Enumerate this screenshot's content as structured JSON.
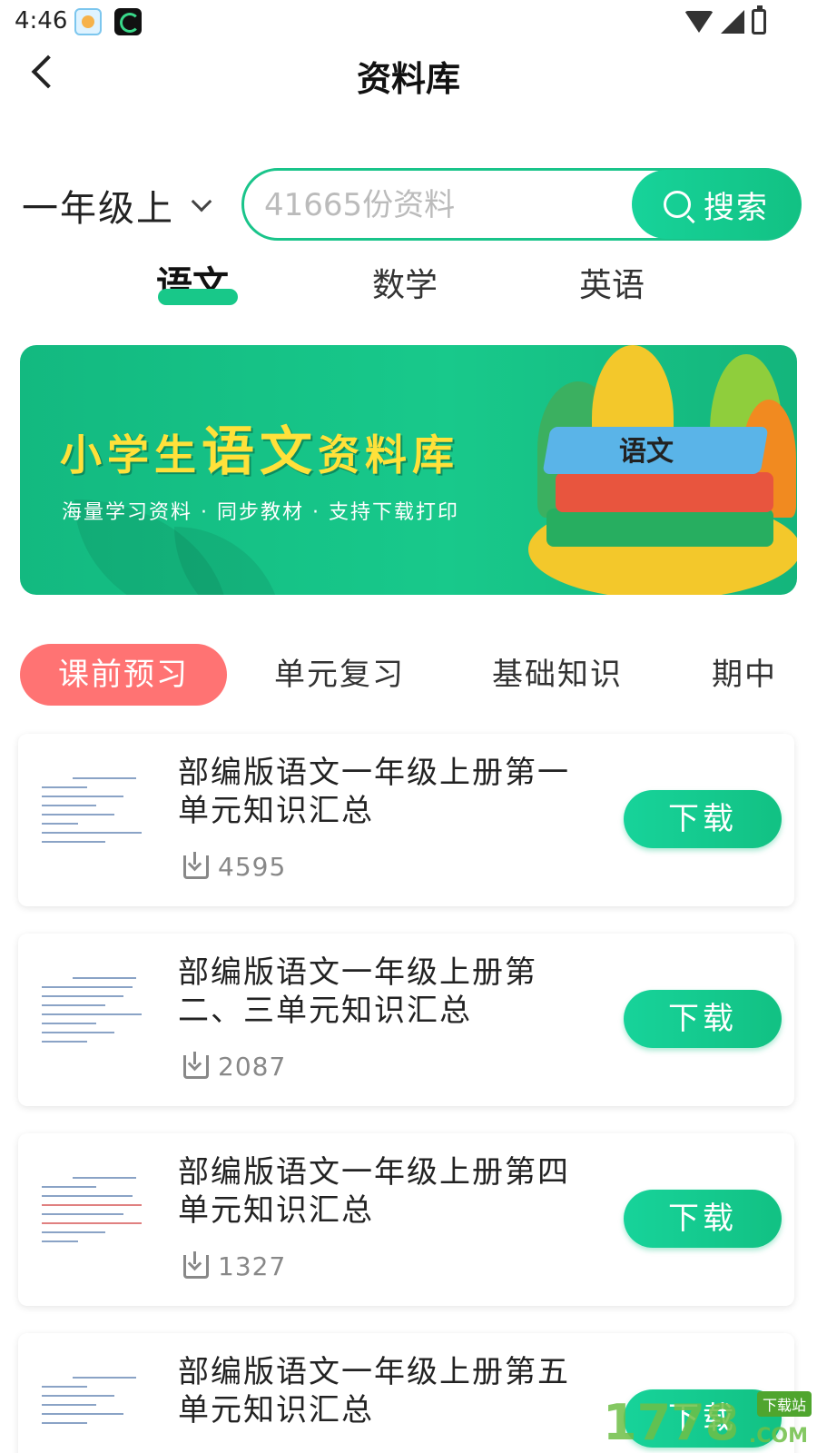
{
  "status_bar": {
    "time": "4:46"
  },
  "header": {
    "title": "资料库"
  },
  "filter": {
    "grade": "一年级上",
    "search_placeholder": "41665份资料",
    "search_button": "搜索"
  },
  "subjects": [
    {
      "label": "语文",
      "active": true
    },
    {
      "label": "数学",
      "active": false
    },
    {
      "label": "英语",
      "active": false
    }
  ],
  "banner": {
    "title_prefix": "小学生",
    "title_highlight": "语文",
    "title_suffix": "资料库",
    "subtitle": "海量学习资料 · 同步教材 · 支持下载打印",
    "book_text": "语文"
  },
  "categories": [
    {
      "label": "课前预习",
      "active": true
    },
    {
      "label": "单元复习",
      "active": false
    },
    {
      "label": "基础知识",
      "active": false
    },
    {
      "label": "期中",
      "active": false
    }
  ],
  "resources": [
    {
      "title": "部编版语文一年级上册第一单元知识汇总",
      "downloads": "4595",
      "button": "下载"
    },
    {
      "title": "部编版语文一年级上册第二、三单元知识汇总",
      "downloads": "2087",
      "button": "下载"
    },
    {
      "title": "部编版语文一年级上册第四单元知识汇总",
      "downloads": "1327",
      "button": "下载"
    },
    {
      "title": "部编版语文一年级上册第五单元知识汇总",
      "downloads": "",
      "button": "下载"
    }
  ],
  "watermark": {
    "number": "1778",
    "badge": "下载站",
    "suffix": ".COM"
  },
  "colors": {
    "accent": "#18c889",
    "chip_active": "#ff7373",
    "banner_title": "#ffe13a"
  }
}
